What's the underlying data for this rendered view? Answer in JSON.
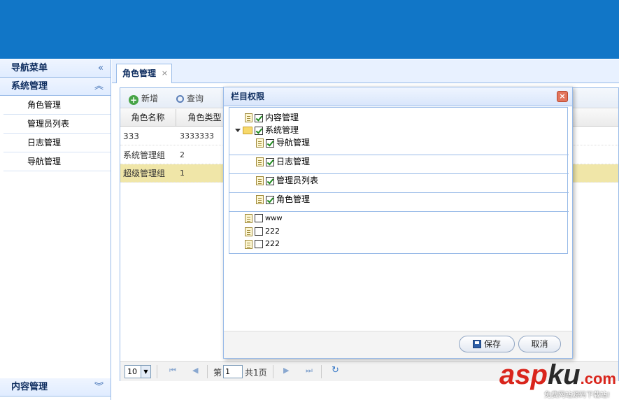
{
  "sidebar": {
    "title": "导航菜单",
    "collapse_icon": "«",
    "section": {
      "title": "系统管理",
      "icon": "︽"
    },
    "items": [
      {
        "label": "角色管理"
      },
      {
        "label": "管理员列表"
      },
      {
        "label": "日志管理"
      },
      {
        "label": "导航管理"
      }
    ],
    "bottom_section": {
      "title": "内容管理",
      "icon": "︾"
    }
  },
  "tab": {
    "label": "角色管理",
    "close": "×"
  },
  "toolbar": {
    "add_label": "新增",
    "query_label": "查询"
  },
  "grid": {
    "columns": [
      "角色名称",
      "角色类型"
    ],
    "rows": [
      {
        "name": "333",
        "type": "3333333",
        "selected": false
      },
      {
        "name": "系统管理组",
        "type": "2",
        "selected": false
      },
      {
        "name": "超级管理组",
        "type": "1",
        "selected": true
      }
    ]
  },
  "pager": {
    "page_size": "10",
    "page_prefix": "第",
    "page_value": "1",
    "page_suffix": "共1页",
    "first_icon": "⏮",
    "prev_icon": "◀",
    "next_icon": "▶",
    "last_icon": "⏭",
    "refresh_icon": "↻"
  },
  "dialog": {
    "title": "栏目权限",
    "close": "×",
    "tree": [
      {
        "label": "内容管理",
        "checked": true,
        "icon": "doc"
      },
      {
        "label": "系统管理",
        "checked": true,
        "icon": "folder"
      },
      {
        "label": "导航管理",
        "checked": true,
        "icon": "doc"
      },
      {
        "label": "日志管理",
        "checked": true,
        "icon": "doc"
      },
      {
        "label": "管理员列表",
        "checked": true,
        "icon": "doc"
      },
      {
        "label": "角色管理",
        "checked": true,
        "icon": "doc"
      },
      {
        "label": "www",
        "checked": false,
        "icon": "doc"
      },
      {
        "label": "222",
        "checked": false,
        "icon": "doc"
      },
      {
        "label": "222",
        "checked": false,
        "icon": "doc"
      }
    ],
    "save_label": "保存",
    "cancel_label": "取消"
  },
  "watermark": {
    "asp": "asp",
    "ku": "ku",
    "com": ".com",
    "sub": "免费网站源码下载站!"
  },
  "colors": {
    "header": "#1176c7",
    "selected_row": "#f0e6a8",
    "border": "#99bbe8"
  }
}
